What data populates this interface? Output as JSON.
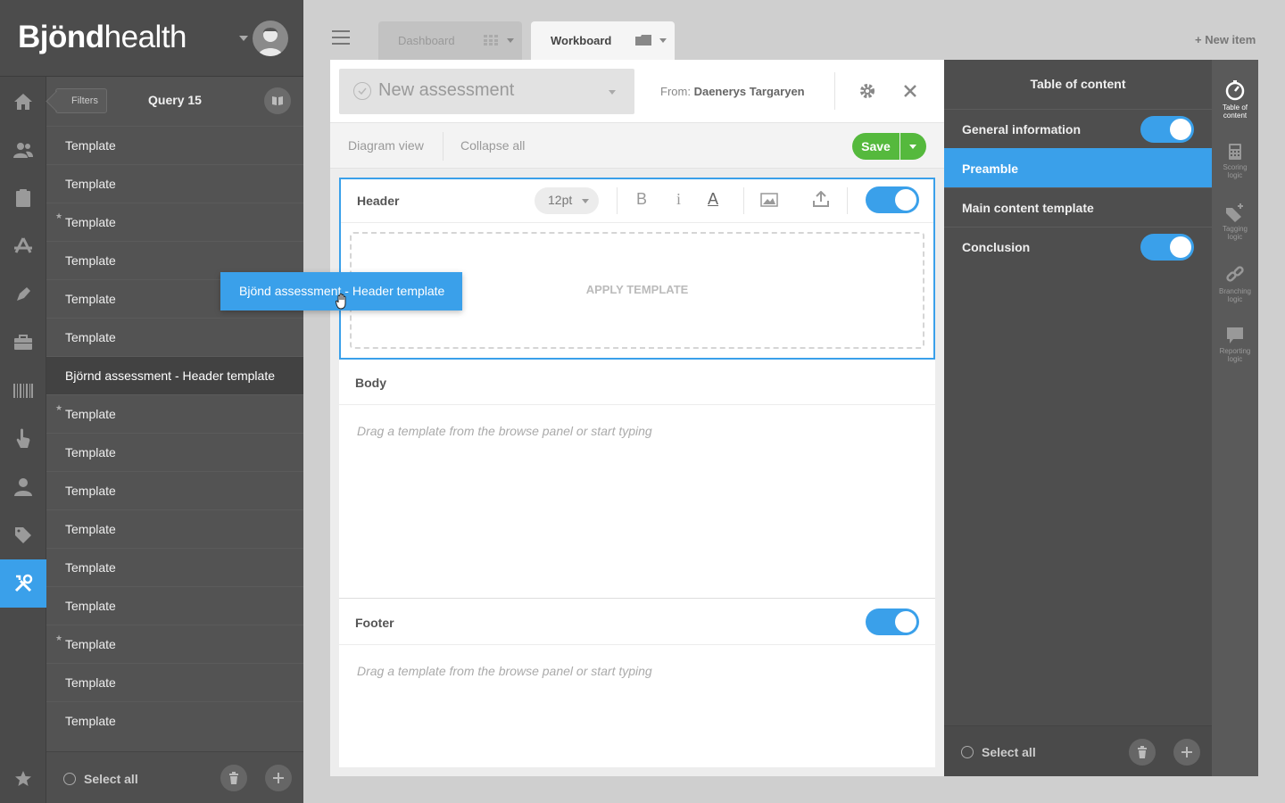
{
  "brand": {
    "bold": "Bjönd",
    "light": "health"
  },
  "tabs": [
    {
      "label": "Dashboard"
    },
    {
      "label": "Workboard"
    }
  ],
  "new_item_label": "+ New item",
  "left_panel": {
    "filters_label": "Filters",
    "query_title": "Query 15",
    "items": [
      {
        "label": "Template",
        "starred": false
      },
      {
        "label": "Template",
        "starred": false
      },
      {
        "label": "Template",
        "starred": true
      },
      {
        "label": "Template",
        "starred": false
      },
      {
        "label": "Template",
        "starred": false
      },
      {
        "label": "Template",
        "starred": false
      },
      {
        "label": "Björnd assessment - Header template",
        "starred": false,
        "selected": true
      },
      {
        "label": "Template",
        "starred": true
      },
      {
        "label": "Template",
        "starred": false
      },
      {
        "label": "Template",
        "starred": false
      },
      {
        "label": "Template",
        "starred": false
      },
      {
        "label": "Template",
        "starred": false
      },
      {
        "label": "Template",
        "starred": false
      },
      {
        "label": "Template",
        "starred": true
      },
      {
        "label": "Template",
        "starred": false
      },
      {
        "label": "Template",
        "starred": false
      }
    ],
    "select_all": "Select all",
    "rail_icons": [
      "home-icon",
      "users-icon",
      "clipboard-icon",
      "app-store-icon",
      "pen-icon",
      "briefcase-icon",
      "barcode-icon",
      "touch-icon",
      "person-icon",
      "tag-icon",
      "tools-icon"
    ],
    "active_rail_icon": "tools-icon",
    "star_icon": "star-icon"
  },
  "editor": {
    "title": "New assessment",
    "from_prefix": "From:",
    "from_name": "Daenerys Targaryen",
    "toolbar": {
      "diagram_view": "Diagram view",
      "collapse_all": "Collapse all",
      "save": "Save"
    },
    "header": {
      "title": "Header",
      "font_size": "12pt",
      "bold": "B",
      "italic": "i",
      "color": "A",
      "apply_template": "APPLY TEMPLATE",
      "enabled": true
    },
    "body": {
      "title": "Body",
      "placeholder": "Drag a template from the browse panel or start typing"
    },
    "footer": {
      "title": "Footer",
      "placeholder": "Drag a template from the browse panel or start typing",
      "enabled": true
    }
  },
  "toc": {
    "title": "Table of content",
    "items": [
      {
        "label": "General information",
        "toggle": true,
        "active": false
      },
      {
        "label": "Preamble",
        "toggle": false,
        "active": true
      },
      {
        "label": "Main content template",
        "toggle": false,
        "active": false
      },
      {
        "label": "Conclusion",
        "toggle": true,
        "active": false
      }
    ],
    "select_all": "Select all",
    "tools": [
      {
        "name": "table-of-content-icon",
        "label_1": "Table of",
        "label_2": "content",
        "active": true
      },
      {
        "name": "scoring-logic-icon",
        "label_1": "Scoring",
        "label_2": "logic",
        "active": false
      },
      {
        "name": "tagging-logic-icon",
        "label_1": "Tagging",
        "label_2": "logic",
        "active": false
      },
      {
        "name": "branching-logic-icon",
        "label_1": "Branching",
        "label_2": "logic",
        "active": false
      },
      {
        "name": "reporting-logic-icon",
        "label_1": "Reporting",
        "label_2": "logic",
        "active": false
      }
    ]
  },
  "drag_ghost_label": "Bjönd assessment - Header template",
  "colors": {
    "accent": "#3aa0ea",
    "save": "#55b93d",
    "sidebar": "#4c4c4c"
  }
}
